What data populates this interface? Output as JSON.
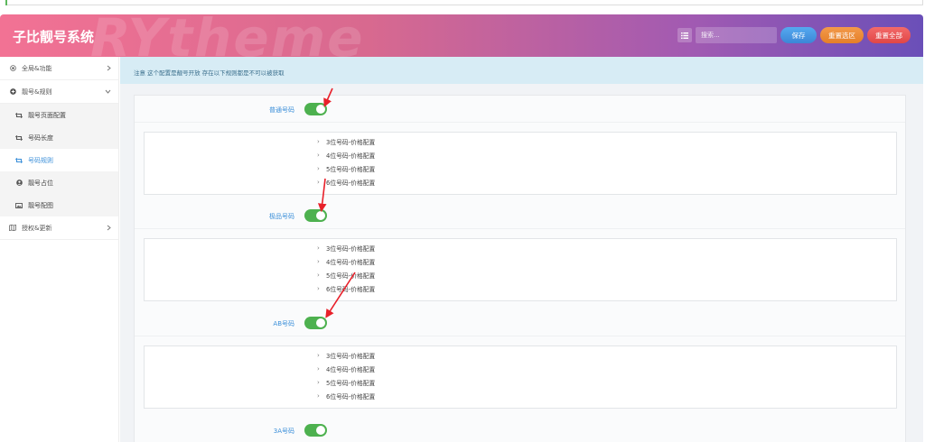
{
  "header": {
    "brand": "子比靓号系统",
    "watermark": "RYtheme",
    "search_placeholder": "搜索...",
    "save_label": "保存",
    "reset_selected_label": "重置选区",
    "reset_all_label": "重置全部",
    "gradient": [
      "#f27294",
      "#6a4fb8"
    ]
  },
  "sidebar": {
    "items": [
      {
        "label": "全局&功能",
        "icon": "dot-circle-icon"
      },
      {
        "label": "靓号&规则",
        "icon": "plus-circle-icon"
      },
      {
        "label": "授权&更新",
        "icon": "map-icon"
      }
    ],
    "subitems": [
      {
        "label": "靓号页面配置",
        "icon": "retweet-icon"
      },
      {
        "label": "号码长度",
        "icon": "retweet-icon"
      },
      {
        "label": "号码规则",
        "icon": "retweet-icon",
        "active": true
      },
      {
        "label": "靓号占位",
        "icon": "user-circle-icon"
      },
      {
        "label": "靓号配图",
        "icon": "image-icon"
      }
    ]
  },
  "notice": "注意 这个配置是靓号开放 存在以下规则都是不可以被获取",
  "sections": [
    {
      "label": "普通号码",
      "enabled": true,
      "items": [
        "3位号码-价格配置",
        "4位号码-价格配置",
        "5位号码-价格配置",
        "6位号码-价格配置"
      ]
    },
    {
      "label": "极品号码",
      "enabled": true,
      "items": [
        "3位号码-价格配置",
        "4位号码-价格配置",
        "5位号码-价格配置",
        "6位号码-价格配置"
      ]
    },
    {
      "label": "AB号码",
      "enabled": true,
      "items": [
        "3位号码-价格配置",
        "4位号码-价格配置",
        "5位号码-价格配置",
        "6位号码-价格配置"
      ]
    },
    {
      "label": "3A号码",
      "enabled": true,
      "items": []
    }
  ],
  "colors": {
    "accent": "#3b8fd9",
    "toggle_on": "#4db14f",
    "notice_bg": "#d7ecf5",
    "annotation_arrow": "#e8202a"
  }
}
